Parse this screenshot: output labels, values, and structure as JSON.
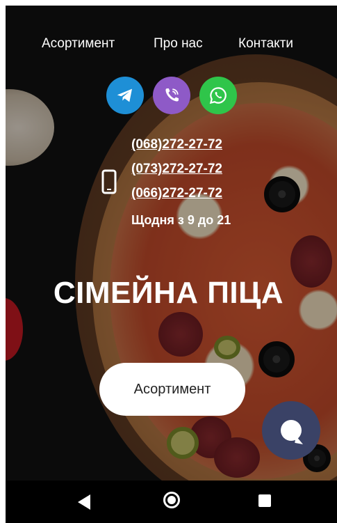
{
  "nav": {
    "items": [
      "Асортимент",
      "Про нас",
      "Контакти"
    ]
  },
  "social": {
    "telegram": {
      "icon": "telegram-icon",
      "color": "#1e8fd6"
    },
    "viber": {
      "icon": "viber-icon",
      "color": "#8e5ac7"
    },
    "whatsapp": {
      "icon": "whatsapp-icon",
      "color": "#2fc54a"
    }
  },
  "contacts": {
    "phones": [
      "(068)272-27-72",
      "(073)272-27-72",
      "(066)272-27-72"
    ],
    "hours": "Щодня з 9 до 21"
  },
  "hero": {
    "title": "СІМЕЙНА ПІЦА",
    "cta_label": "Асортимент"
  },
  "chat": {
    "icon": "chat-bubble-icon",
    "color": "#3a4266"
  },
  "system_nav": {
    "back": "back-icon",
    "home": "home-icon",
    "recents": "recents-icon"
  }
}
